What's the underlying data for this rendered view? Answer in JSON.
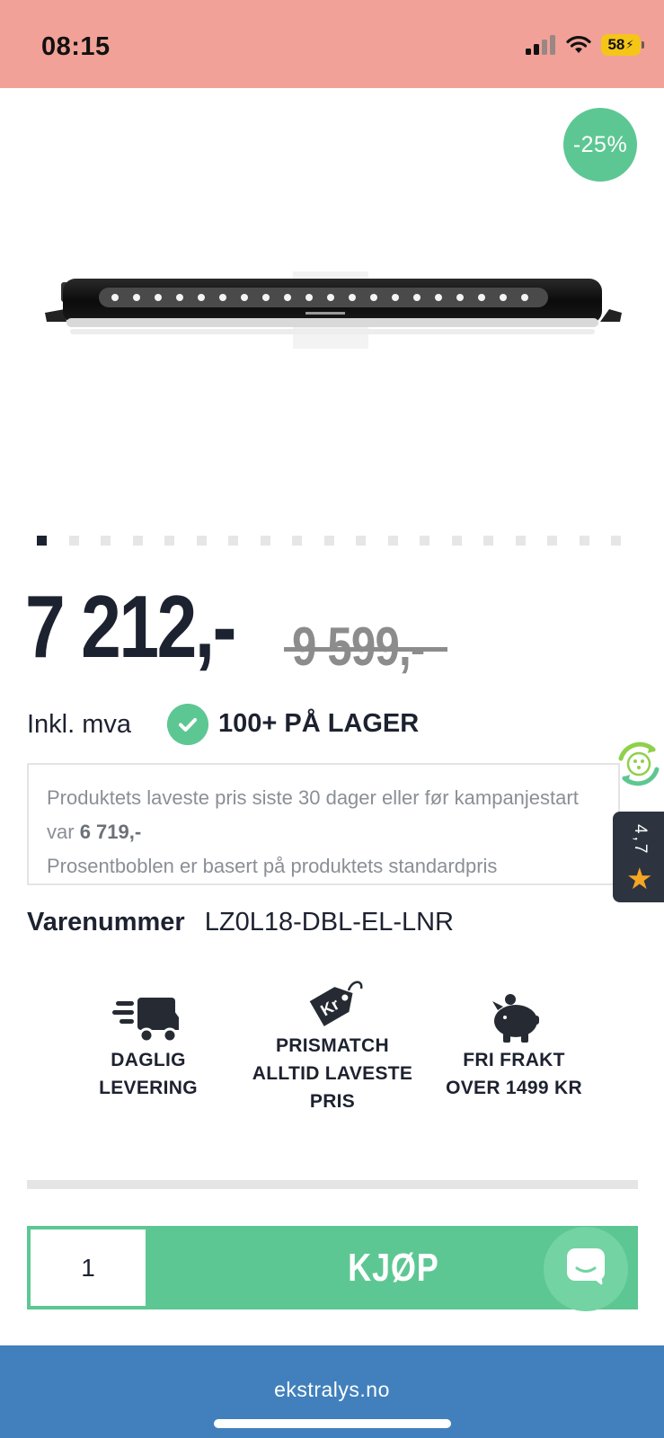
{
  "status_bar": {
    "time": "08:15",
    "battery": "58"
  },
  "discount_badge": "-25%",
  "carousel": {
    "total": 19,
    "active_index": 0
  },
  "price": {
    "current": "7 212,-",
    "original": "9 599,-",
    "vat_label": "Inkl. mva",
    "stock": "100+ PÅ LAGER"
  },
  "info_box": {
    "line1_prefix": "Produktets laveste pris siste 30 dager eller før kampanjestart var ",
    "lowest_price": "6 719,-",
    "line2": "Prosentboblen er basert på produktets standardpris"
  },
  "rating": {
    "value": "4,7"
  },
  "sku": {
    "label": "Varenummer",
    "value": "LZ0L18-DBL-EL-LNR"
  },
  "features": [
    {
      "icon": "delivery-truck-icon",
      "line1": "DAGLIG",
      "line2": "LEVERING",
      "line3": ""
    },
    {
      "icon": "price-tag-icon",
      "line1": "PRISMATCH",
      "line2": "ALLTID LAVESTE",
      "line3": "PRIS"
    },
    {
      "icon": "piggy-bank-icon",
      "line1": "FRI FRAKT",
      "line2": "OVER 1499 KR",
      "line3": ""
    }
  ],
  "purchase": {
    "quantity": "1",
    "buy_label": "KJØP"
  },
  "url_bar": {
    "url": "ekstralys.no"
  },
  "colors": {
    "accent": "#5dc793",
    "status_bar": "#f1a197",
    "url_bar": "#4180bc",
    "dark": "#1d2230"
  }
}
